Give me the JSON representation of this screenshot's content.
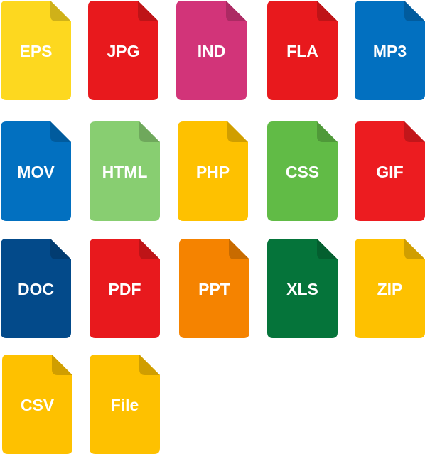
{
  "colors": {
    "fold_shade": "rgba(0,0,0,0.18)",
    "label": "#ffffff"
  },
  "files": [
    {
      "label": "EPS",
      "icon": "eps-file-icon",
      "color": "#FDD81F"
    },
    {
      "label": "JPG",
      "icon": "jpg-file-icon",
      "color": "#E8191D"
    },
    {
      "label": "IND",
      "icon": "ind-file-icon",
      "color": "#D23479"
    },
    {
      "label": "FLA",
      "icon": "fla-file-icon",
      "color": "#E8191D"
    },
    {
      "label": "MP3",
      "icon": "mp3-file-icon",
      "color": "#0270C0"
    },
    {
      "label": "MOV",
      "icon": "mov-file-icon",
      "color": "#0270C0"
    },
    {
      "label": "HTML",
      "icon": "html-file-icon",
      "color": "#88CE71"
    },
    {
      "label": "PHP",
      "icon": "php-file-icon",
      "color": "#FEC100"
    },
    {
      "label": "CSS",
      "icon": "css-file-icon",
      "color": "#61BB46"
    },
    {
      "label": "GIF",
      "icon": "gif-file-icon",
      "color": "#EC1C20"
    },
    {
      "label": "DOC",
      "icon": "doc-file-icon",
      "color": "#034A8A"
    },
    {
      "label": "PDF",
      "icon": "pdf-file-icon",
      "color": "#E8191D"
    },
    {
      "label": "PPT",
      "icon": "ppt-file-icon",
      "color": "#F58300"
    },
    {
      "label": "XLS",
      "icon": "xls-file-icon",
      "color": "#05743A"
    },
    {
      "label": "ZIP",
      "icon": "zip-file-icon",
      "color": "#FEC100"
    },
    {
      "label": "CSV",
      "icon": "csv-file-icon",
      "color": "#FEC100"
    },
    {
      "label": "File",
      "icon": "generic-file-icon",
      "color": "#FEC100"
    }
  ]
}
